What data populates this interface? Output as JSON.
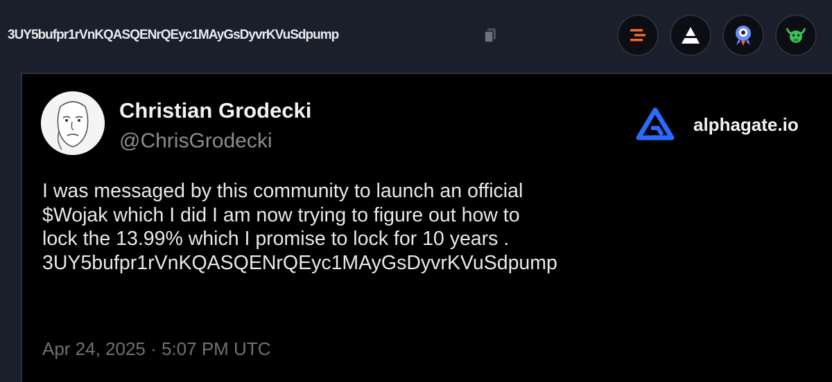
{
  "topbar": {
    "contract_address": "3UY5bufpr1rVnKQASQENrQEyc1MAyGsDyvrKVuSdpump",
    "copy_icon": "copy-icon",
    "buttons": [
      {
        "name": "bars-icon",
        "color": "#f26a21"
      },
      {
        "name": "triangle-logo-icon",
        "color": "#ffffff"
      },
      {
        "name": "rocket-mascot-icon",
        "color": "#6c8cff"
      },
      {
        "name": "bull-icon",
        "color": "#3fbf5a"
      }
    ]
  },
  "tweet": {
    "author_name": "Christian Grodecki",
    "author_handle": "@ChrisGrodecki",
    "brand_name": "alphagate.io",
    "brand_color": "#2a6bff",
    "lines": [
      "I was messaged by this community to launch an official",
      "$Wojak which I did I am now trying to figure out how to",
      "lock the 13.99% which I promise to lock for 10 years .",
      "3UY5bufpr1rVnKQASQENrQEyc1MAyGsDyvrKVuSdpump"
    ],
    "timestamp": "Apr 24, 2025 · 5:07 PM UTC"
  }
}
